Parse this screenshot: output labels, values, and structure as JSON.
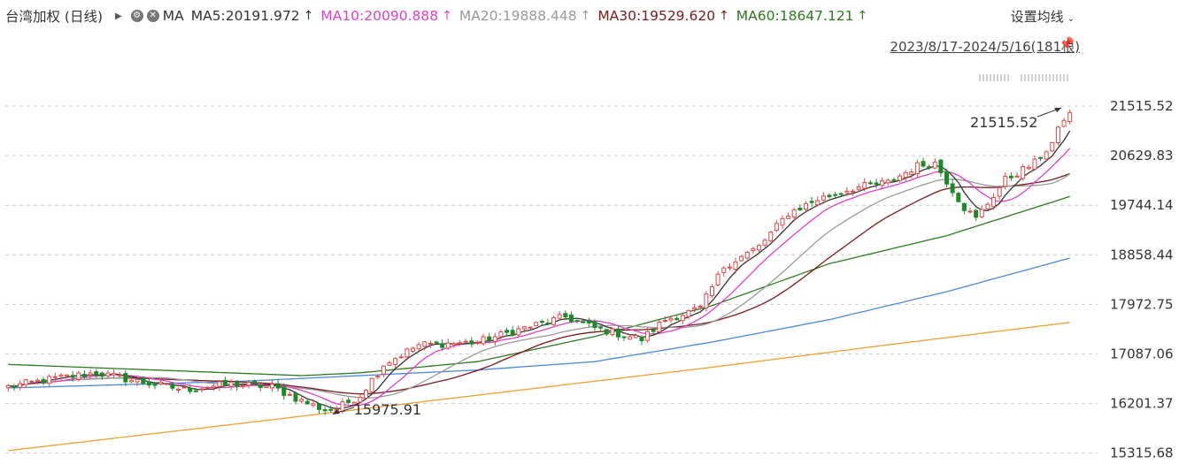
{
  "header": {
    "index_name": "台湾加权 (日线)",
    "ma_label": "MA",
    "ma_items": [
      {
        "label": "MA5:20191.972",
        "color": "#333333",
        "arrow": "↑"
      },
      {
        "label": "MA10:20090.888",
        "color": "#e040c8",
        "arrow": "↑"
      },
      {
        "label": "MA20:19888.448",
        "color": "#9a9a9a",
        "arrow": "↑"
      },
      {
        "label": "MA30:19529.620",
        "color": "#7a1a1a",
        "arrow": "↑"
      },
      {
        "label": "MA60:18647.121",
        "color": "#2a7a1e",
        "arrow": "↑"
      }
    ],
    "settings_label": "设置均线",
    "date_range": "2023/8/17-2024/5/16(181根)"
  },
  "chart_data": {
    "type": "candlestick",
    "ylim": [
      15200,
      21800
    ],
    "y_ticks": [
      21515.52,
      20629.83,
      19744.14,
      18858.44,
      17972.75,
      17087.06,
      16201.37,
      15315.68
    ],
    "y_tick_labels": [
      "21515.52",
      "20629.83",
      "19744.14",
      "18858.44",
      "17972.75",
      "17087.06",
      "16201.37",
      "15315.68"
    ],
    "annotations": [
      {
        "label": "21515.52",
        "bar": 180,
        "value": 21515.52
      },
      {
        "label": "15975.91",
        "bar": 55,
        "value": 15975.91
      }
    ],
    "anchors": [
      [
        0,
        16500
      ],
      [
        8,
        16650
      ],
      [
        15,
        16750
      ],
      [
        22,
        16600
      ],
      [
        30,
        16450
      ],
      [
        38,
        16550
      ],
      [
        45,
        16500
      ],
      [
        50,
        16250
      ],
      [
        55,
        16050
      ],
      [
        60,
        16350
      ],
      [
        64,
        16900
      ],
      [
        70,
        17250
      ],
      [
        80,
        17300
      ],
      [
        88,
        17550
      ],
      [
        95,
        17750
      ],
      [
        100,
        17550
      ],
      [
        108,
        17350
      ],
      [
        112,
        17700
      ],
      [
        118,
        17900
      ],
      [
        122,
        18650
      ],
      [
        128,
        19000
      ],
      [
        133,
        19600
      ],
      [
        138,
        19850
      ],
      [
        144,
        20050
      ],
      [
        150,
        20150
      ],
      [
        155,
        20450
      ],
      [
        158,
        20500
      ],
      [
        163,
        19700
      ],
      [
        165,
        19500
      ],
      [
        170,
        20200
      ],
      [
        175,
        20500
      ],
      [
        178,
        20850
      ],
      [
        181,
        21515
      ]
    ],
    "series": [
      {
        "name": "MA5",
        "color": "#333333",
        "period": 5
      },
      {
        "name": "MA10",
        "color": "#e040c8",
        "period": 10
      },
      {
        "name": "MA20",
        "color": "#9a9a9a",
        "period": 20
      },
      {
        "name": "MA30",
        "color": "#7a1a1a",
        "period": 30
      },
      {
        "name": "MA60",
        "color": "#2a7a1e",
        "points": [
          [
            0,
            16900
          ],
          [
            50,
            16700
          ],
          [
            60,
            16750
          ],
          [
            80,
            16950
          ],
          [
            100,
            17400
          ],
          [
            120,
            17950
          ],
          [
            140,
            18700
          ],
          [
            160,
            19200
          ],
          [
            181,
            19900
          ]
        ]
      },
      {
        "name": "MA120",
        "color": "#4a8ad8",
        "points": [
          [
            0,
            16480
          ],
          [
            40,
            16600
          ],
          [
            60,
            16700
          ],
          [
            80,
            16800
          ],
          [
            100,
            16950
          ],
          [
            120,
            17300
          ],
          [
            140,
            17700
          ],
          [
            160,
            18200
          ],
          [
            181,
            18800
          ]
        ]
      },
      {
        "name": "MA250",
        "color": "#f0a030",
        "points": [
          [
            0,
            15360
          ],
          [
            40,
            15850
          ],
          [
            80,
            16350
          ],
          [
            120,
            16850
          ],
          [
            150,
            17250
          ],
          [
            181,
            17650
          ]
        ]
      }
    ],
    "grid": true
  }
}
